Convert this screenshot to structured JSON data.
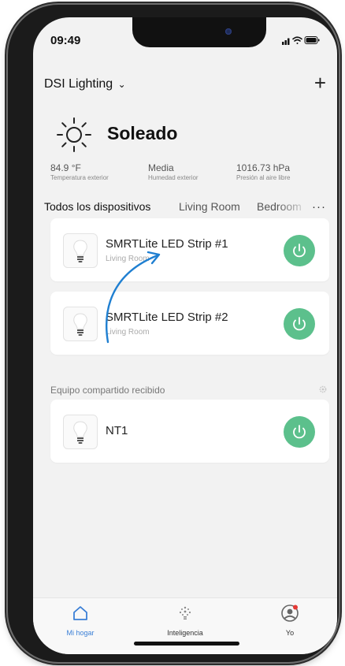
{
  "status": {
    "time": "09:49"
  },
  "header": {
    "home_name": "DSI Lighting",
    "add_icon": "plus-icon"
  },
  "weather": {
    "condition": "Soleado",
    "icon": "sun-icon",
    "stats": [
      {
        "value": "84.9 °F",
        "label": "Temperatura exterior"
      },
      {
        "value": "Media",
        "label": "Humedad exterior"
      },
      {
        "value": "1016.73 hPa",
        "label": "Presión al aire libre"
      }
    ]
  },
  "tabs": {
    "items": [
      {
        "label": "Todos los dispositivos",
        "active": true
      },
      {
        "label": "Living Room",
        "active": false
      },
      {
        "label": "Bedroom",
        "active": false
      }
    ],
    "more_label": "···"
  },
  "devices": [
    {
      "name": "SMRTLite LED Strip #1",
      "room": "Living Room",
      "icon": "bulb-icon",
      "power": "on"
    },
    {
      "name": "SMRTLite LED Strip #2",
      "room": "Living Room",
      "icon": "bulb-icon",
      "power": "on"
    }
  ],
  "shared": {
    "section_label": "Equipo compartido recibido",
    "devices": [
      {
        "name": "NT1",
        "icon": "bulb-icon",
        "power": "on"
      }
    ]
  },
  "tabbar": {
    "items": [
      {
        "label": "Mi hogar",
        "icon": "house-icon",
        "active": true
      },
      {
        "label": "Inteligencia",
        "icon": "smart-scene-icon",
        "active": false
      },
      {
        "label": "Yo",
        "icon": "profile-icon",
        "active": false
      }
    ]
  },
  "colors": {
    "accent": "#3a7fd6",
    "power_on": "#5cc08c",
    "annotation_arrow": "#1f7fd1"
  }
}
